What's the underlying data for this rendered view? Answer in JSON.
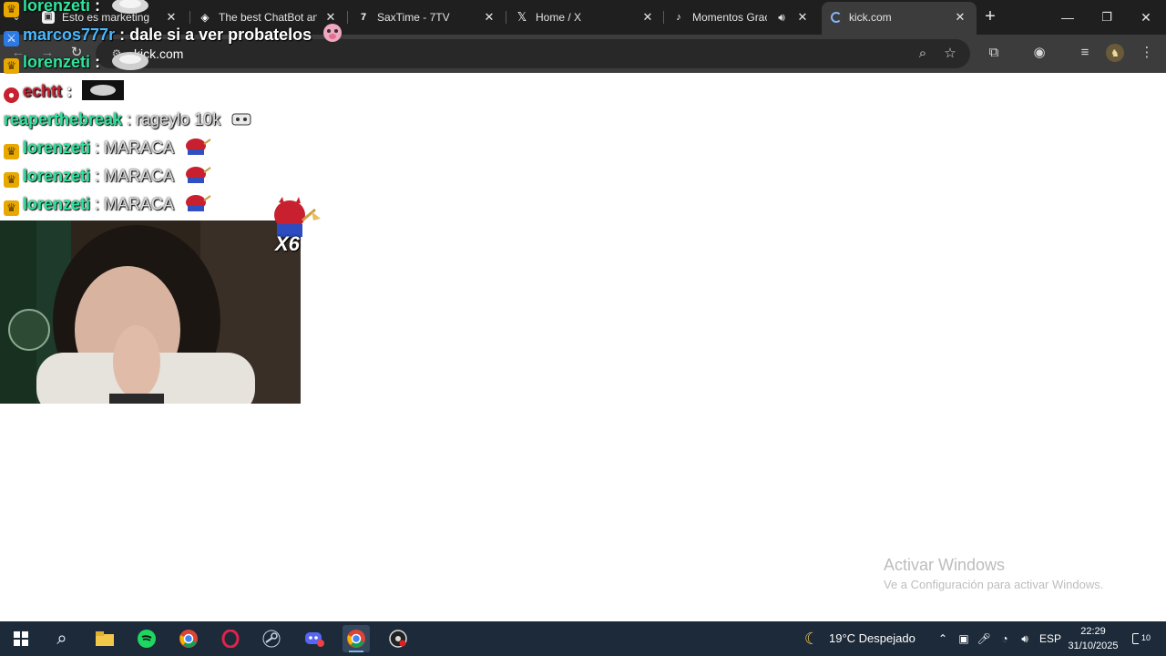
{
  "browser": {
    "tabs": [
      {
        "title": "Esto es marketing",
        "favicon": "notebook-icon"
      },
      {
        "title": "The best ChatBot and",
        "favicon": "chatbot-icon"
      },
      {
        "title": "SaxTime - 7TV",
        "favicon": "7tv-icon"
      },
      {
        "title": "Home / X",
        "favicon": "x-icon"
      },
      {
        "title": "Momentos Gracio",
        "favicon": "tiktok-icon",
        "audio": true
      },
      {
        "title": "kick.com",
        "favicon": "loading-icon",
        "active": true
      }
    ],
    "address": "kick.com"
  },
  "chat": [
    {
      "badge": "crown",
      "user": "lorenzeti",
      "sep": " :",
      "message": "",
      "user_color": "#2ee59d"
    },
    {
      "badge": "sword",
      "user": "marcos777r",
      "sep": " :",
      "message": " dale si a ver probatelos",
      "user_color": "#49b8ff"
    },
    {
      "badge": "crown",
      "user": "lorenzeti",
      "sep": " :",
      "message": "",
      "user_color": "#2ee59d"
    },
    {
      "badge": "verified",
      "user": "echtt",
      "sep": " :",
      "message": "",
      "user_color": "#c8202f"
    },
    {
      "badge": "",
      "user": "reaperthebreak",
      "sep": " :",
      "message": " rageylo 10k",
      "user_color": "#2ee59d"
    },
    {
      "badge": "crown",
      "user": "lorenzeti",
      "sep": " :",
      "message": " MARACA",
      "user_color": "#2ee59d"
    },
    {
      "badge": "crown",
      "user": "lorenzeti",
      "sep": " :",
      "message": " MARACA",
      "user_color": "#2ee59d"
    },
    {
      "badge": "crown",
      "user": "lorenzeti",
      "sep": " :",
      "message": " MARACA",
      "user_color": "#2ee59d"
    }
  ],
  "sticker_count": "X6",
  "watermark": {
    "line1": "Activar Windows",
    "line2": "Ve a Configuración para activar Windows."
  },
  "taskbar": {
    "apps": [
      "windows-start-icon",
      "search-icon",
      "file-explorer-icon",
      "spotify-icon",
      "chrome-icon",
      "opera-gx-icon",
      "steam-icon",
      "discord-icon",
      "chrome-icon",
      "obs-icon"
    ],
    "weather": "19°C  Despejado",
    "language": "ESP",
    "time": "22:29",
    "date": "31/10/2025",
    "notifications": "10"
  },
  "colors": {
    "tabstrip_bg": "#1f1f1f",
    "toolbar_bg": "#3c3c3c",
    "taskbar_bg": "#1c2a3a",
    "crown_badge": "#e8a800"
  }
}
